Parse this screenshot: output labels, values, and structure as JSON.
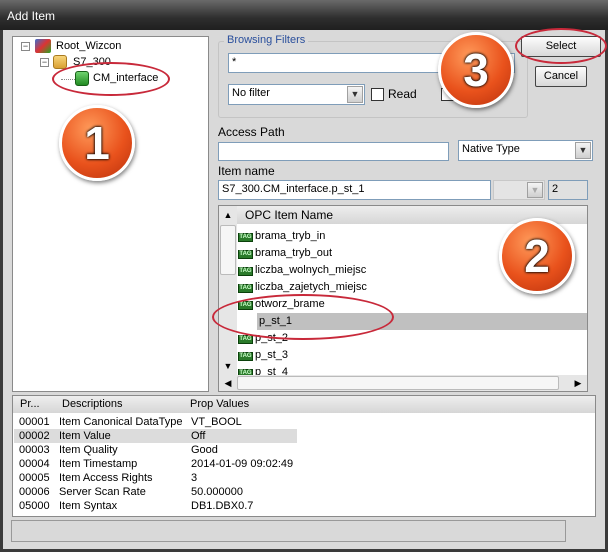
{
  "window": {
    "title": "Add Item"
  },
  "tree": {
    "root": "Root_Wizcon",
    "device": "S7_300",
    "selected": "CM_interface"
  },
  "filters": {
    "legend": "Browsing Filters",
    "filter_value": "*",
    "type_filter": "No filter",
    "read_label": "Read",
    "read_checked": false
  },
  "buttons": {
    "select": "Select",
    "cancel": "Cancel"
  },
  "access_path": {
    "label": "Access Path",
    "value": "",
    "type_combo": "Native Type"
  },
  "item_name": {
    "label": "Item name",
    "value": "S7_300.CM_interface.p_st_1",
    "count": "2"
  },
  "items_list": {
    "header": "OPC Item Name",
    "icon": "tag-icon",
    "selected": "p_st_1",
    "items": [
      "brama_tryb_in",
      "brama_tryb_out",
      "liczba_wolnych_miejsc",
      "liczba_zajetych_miejsc",
      "otworz_brame",
      "p_st_1",
      "p_st_2",
      "p_st_3",
      "p_st_4"
    ]
  },
  "props": {
    "headers": [
      "Pr...",
      "Descriptions",
      "Prop Values"
    ],
    "rows": [
      {
        "id": "00001",
        "desc": "Item Canonical DataType",
        "value": "VT_BOOL"
      },
      {
        "id": "00002",
        "desc": "Item Value",
        "value": "Off"
      },
      {
        "id": "00003",
        "desc": "Item Quality",
        "value": "Good"
      },
      {
        "id": "00004",
        "desc": "Item Timestamp",
        "value": "2014-01-09 09:02:49"
      },
      {
        "id": "00005",
        "desc": "Item Access Rights",
        "value": "3"
      },
      {
        "id": "00006",
        "desc": "Server Scan Rate",
        "value": "50.000000"
      },
      {
        "id": "05000",
        "desc": "Item Syntax",
        "value": "DB1.DBX0.7"
      }
    ]
  },
  "annotations": {
    "step1": "1",
    "step2": "2",
    "step3": "3",
    "color": "#c8293a"
  }
}
